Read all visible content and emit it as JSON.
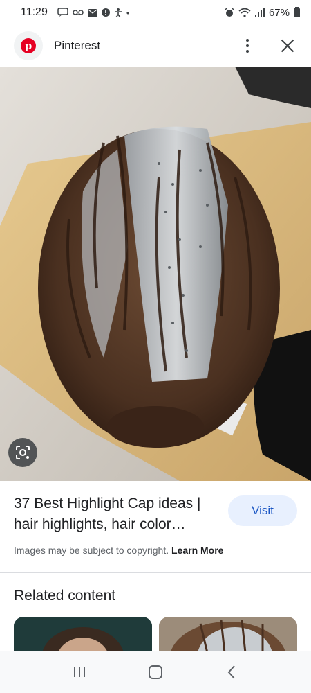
{
  "status_bar": {
    "time": "11:29",
    "battery": "67%"
  },
  "header": {
    "site_name": "Pinterest",
    "logo_letter": "p"
  },
  "result": {
    "title": "37 Best Highlight Cap ideas | hair highlights, hair color…",
    "visit_label": "Visit",
    "copyright_text": "Images may be subject to copyright.",
    "learn_more": "Learn More"
  },
  "related": {
    "heading": "Related content"
  },
  "icons": {
    "lens": "google-lens-icon",
    "more": "more-vert-icon",
    "close": "close-icon",
    "nav_recents": "recents-icon",
    "nav_home": "home-icon",
    "nav_back": "back-icon"
  },
  "colors": {
    "pinterest_red": "#e60023",
    "visit_bg": "#e8f0fe",
    "visit_text": "#1a56c4"
  }
}
